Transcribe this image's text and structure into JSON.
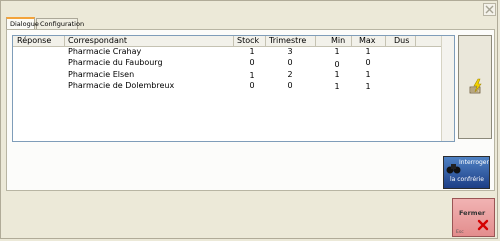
{
  "tabs": [
    {
      "label": "Dialogue",
      "active": true
    },
    {
      "label": "Configuration",
      "active": false
    }
  ],
  "grid": {
    "columns": [
      "Réponse",
      "Correspondant",
      "Stock",
      "Trimestre",
      "Min",
      "Max",
      "Dus"
    ],
    "rows": [
      {
        "reponse": "",
        "correspondant": "Pharmacie Crahay",
        "stock": "1",
        "trimestre": "3",
        "min": "1",
        "max": "1",
        "dus": ""
      },
      {
        "reponse": "",
        "correspondant": "Pharmacie du Faubourg",
        "stock": "0",
        "trimestre": "0",
        "min": "0",
        "max": "0",
        "dus": ""
      },
      {
        "reponse": "",
        "correspondant": "Pharmacie Elsen",
        "stock": "1",
        "trimestre": "2",
        "min": "1",
        "max": "1",
        "dus": ""
      },
      {
        "reponse": "",
        "correspondant": "Pharmacie de Dolembreux",
        "stock": "0",
        "trimestre": "0",
        "min": "1",
        "max": "1",
        "dus": ""
      }
    ]
  },
  "buttons": {
    "interroger_line1": "Interroger",
    "interroger_line2": "la confrérie",
    "fermer_label": "Fermer",
    "fermer_shortcut": "Esc"
  },
  "icons": {
    "close": "close-icon",
    "edit": "edit-lightning-icon",
    "interroger": "binoculars-icon",
    "fermer": "red-x-icon"
  },
  "colors": {
    "fermer_bg": "#e9a0a0",
    "interroger_bg": "#2f5aa5",
    "tab_accent": "#f3a33b"
  }
}
